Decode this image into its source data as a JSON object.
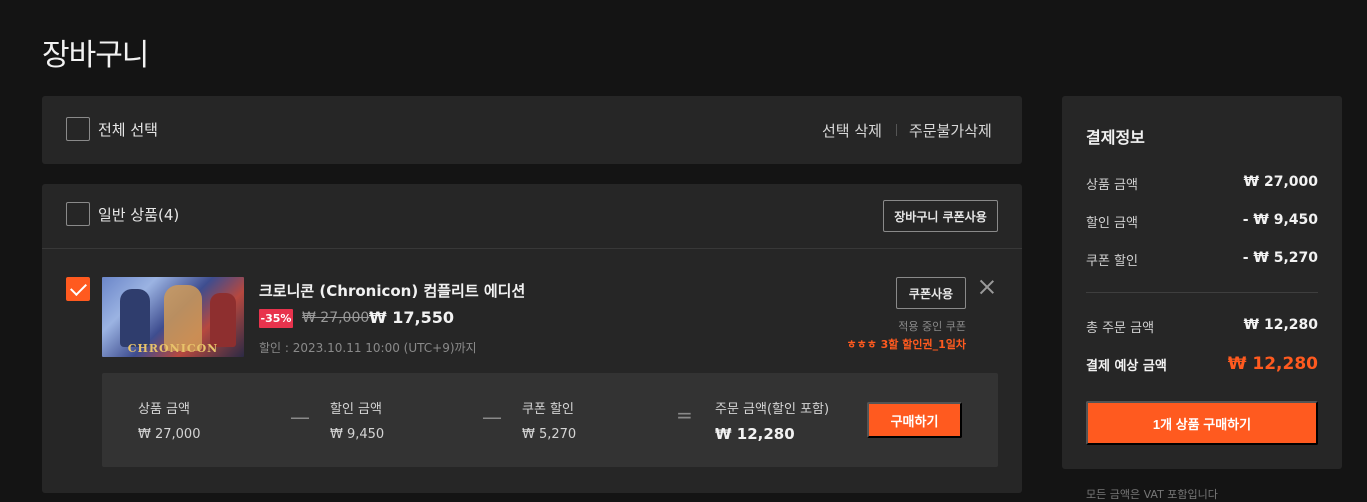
{
  "page": {
    "title": "장바구니"
  },
  "select_bar": {
    "select_all_label": "전체 선택",
    "delete_selected": "선택 삭제",
    "delete_unavailable": "주문불가삭제"
  },
  "section": {
    "label": "일반 상품(4)",
    "cart_coupon_button": "장바구니 쿠폰사용"
  },
  "item": {
    "checked": true,
    "thumb_logo": "CHRONICON",
    "title": "크로니콘 (Chronicon) 컴플리트 에디션",
    "discount_badge": "-35%",
    "original_price": "₩ 27,000",
    "sale_price": "₩ 17,550",
    "sale_period": "할인 : 2023.10.11 10:00 (UTC+9)까지",
    "coupon_button": "쿠폰사용",
    "applied_coupon_label": "적용 중인 쿠폰",
    "applied_coupon_name": "ㅎㅎㅎ 3할 할인권_1일차"
  },
  "item_summary": {
    "product_amount_label": "상품 금액",
    "product_amount": "₩ 27,000",
    "minus1": "—",
    "discount_amount_label": "할인 금액",
    "discount_amount": "₩ 9,450",
    "minus2": "—",
    "coupon_discount_label": "쿠폰 할인",
    "coupon_discount": "₩ 5,270",
    "equals": "=",
    "order_amount_label": "주문 금액(할인 포함)",
    "order_amount": "₩ 12,280",
    "buy_button": "구매하기"
  },
  "payment": {
    "title": "결제정보",
    "rows": [
      {
        "label": "상품 금액",
        "value": "₩ 27,000"
      },
      {
        "label": "할인 금액",
        "value": "- ₩ 9,450"
      },
      {
        "label": "쿠폰 할인",
        "value": "- ₩ 5,270"
      },
      {
        "label": "총 주문 금액",
        "value": "₩ 12,280"
      },
      {
        "label": "결제 예상 금액",
        "value": "₩ 12,280"
      }
    ],
    "buy_button": "1개 상품 구매하기",
    "footnote": "모든 금액은 VAT 포함입니다"
  },
  "colors": {
    "accent": "#ff5a1f",
    "badge": "#e8334d",
    "panel": "#262626",
    "background": "#141414"
  }
}
